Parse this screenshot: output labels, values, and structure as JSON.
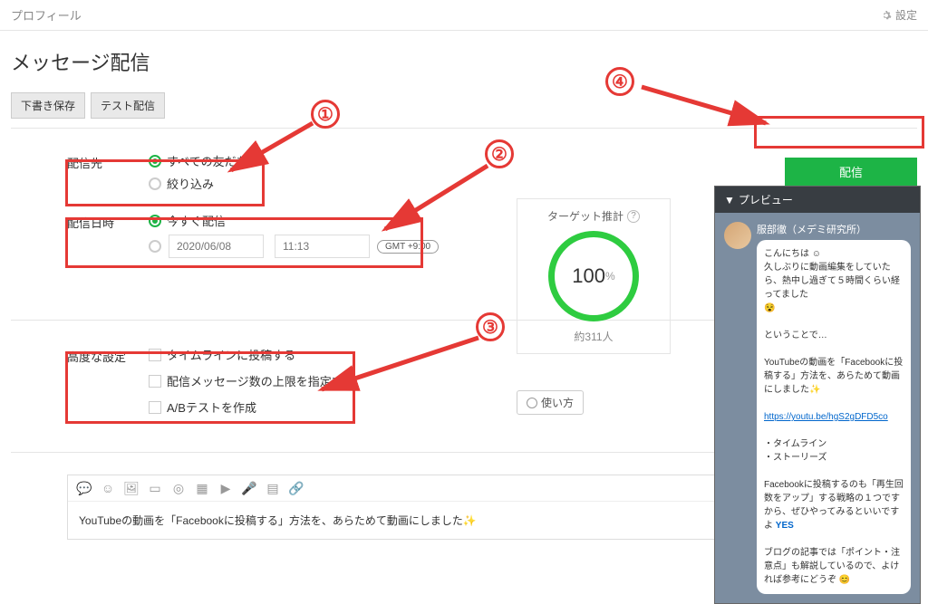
{
  "topbar": {
    "profile": "プロフィール",
    "settings": "設定"
  },
  "page": {
    "title": "メッセージ配信"
  },
  "buttons": {
    "save_draft": "下書き保存",
    "test_send": "テスト配信",
    "send": "配信"
  },
  "dest": {
    "label": "配信先",
    "opt_all": "すべての友だち",
    "opt_filter": "絞り込み"
  },
  "datetime": {
    "label": "配信日時",
    "opt_now": "今すぐ配信",
    "date_placeholder": "2020/06/08",
    "time_placeholder": "11:13",
    "tz": "GMT +9:00"
  },
  "target": {
    "title": "ターゲット推計",
    "percent": "100",
    "pct_label": "%",
    "count": "約311人"
  },
  "advanced": {
    "label": "高度な設定",
    "opt_timeline": "タイムラインに投稿する",
    "opt_limit": "配信メッセージ数の上限を指定する",
    "opt_ab": "A/Bテストを作成",
    "howto": "使い方"
  },
  "editor": {
    "content": "YouTubeの動画を「Facebookに投稿する」方法を、あらためて動画にしました✨"
  },
  "preview": {
    "header": "プレビュー",
    "sender": "服部徹（メデミ研究所）",
    "msg_l1": "こんにちは",
    "msg_l2": "久しぶりに動画編集をしていたら、熱中し過ぎて５時間くらい経ってました",
    "msg_l3": "ということで…",
    "msg_l4": "YouTubeの動画を「Facebookに投稿する」方法を、あらためて動画にしました✨",
    "link": "https://youtu.be/hgS2gDFD5co",
    "bullet1": "・タイムライン",
    "bullet2": "・ストーリーズ",
    "msg_l5": "Facebookに投稿するのも「再生回数をアップ」する戦略の１つですから、ぜひやってみるといいですよ",
    "yes": "YES",
    "msg_l6": "ブログの記事では「ポイント・注意点」も解説しているので、よければ参考にどうぞ"
  },
  "annotations": {
    "n1": "①",
    "n2": "②",
    "n3": "③",
    "n4": "④"
  }
}
